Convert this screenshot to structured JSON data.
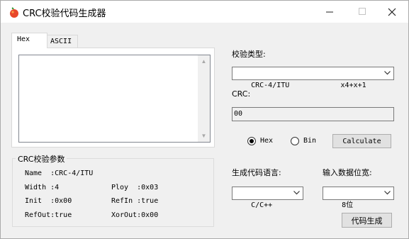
{
  "window": {
    "title": "CRC校验代码生成器"
  },
  "tabs": [
    {
      "label": "Hex",
      "active": true
    },
    {
      "label": "ASCII",
      "active": false
    }
  ],
  "input": {
    "value": ""
  },
  "params": {
    "title": "CRC校验参数",
    "name": "Name  :CRC-4/ITU",
    "width": "Width :4",
    "ploy": "Ploy  :0x03",
    "init": "Init  :0x00",
    "refin": "RefIn :true",
    "refout": "RefOut:true",
    "xorout": "XorOut:0x00"
  },
  "crc_type": {
    "label": "校验类型:",
    "selected": "CRC-4/ITU            x4+x+1"
  },
  "crc": {
    "label": "CRC:",
    "value": "00"
  },
  "radix": {
    "hex": "Hex",
    "bin": "Bin",
    "selected": "Hex"
  },
  "buttons": {
    "calculate": "Calculate",
    "generate": "代码生成"
  },
  "lang": {
    "label": "生成代码语言:",
    "selected": "C/C++"
  },
  "width_select": {
    "label": "输入数据位宽:",
    "selected": "8位"
  }
}
